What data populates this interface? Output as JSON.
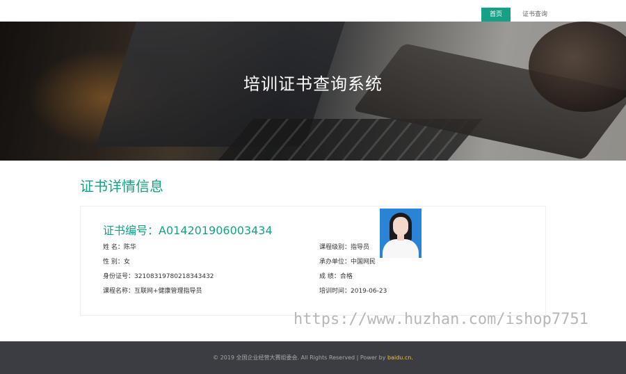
{
  "nav": {
    "home_label": "首页",
    "cert_query_label": "证书查询"
  },
  "banner": {
    "title": "培训证书查询系统"
  },
  "section": {
    "title": "证书详情信息"
  },
  "certificate": {
    "number_label": "证书编号：",
    "number": "A014201906003434",
    "left_fields": [
      "姓 名：陈华",
      "性 别：女",
      "身份证号：32108319780218343432",
      "课程名称：互联网+健康管理指导员"
    ],
    "right_fields": [
      "课程级别：指导员",
      "承办单位：中国网民",
      "成 绩：合格",
      "培训时间：2019-06-23"
    ]
  },
  "watermark": "https://www.huzhan.com/ishop7751",
  "footer": {
    "copyright": "© 2019 全国企业经营大赛组委会. All Rights Reserved | Power by ",
    "link": "baidu.cn."
  },
  "colors": {
    "accent": "#16a085",
    "footer_bg": "#3c3d42",
    "footer_link": "#f4c430"
  }
}
